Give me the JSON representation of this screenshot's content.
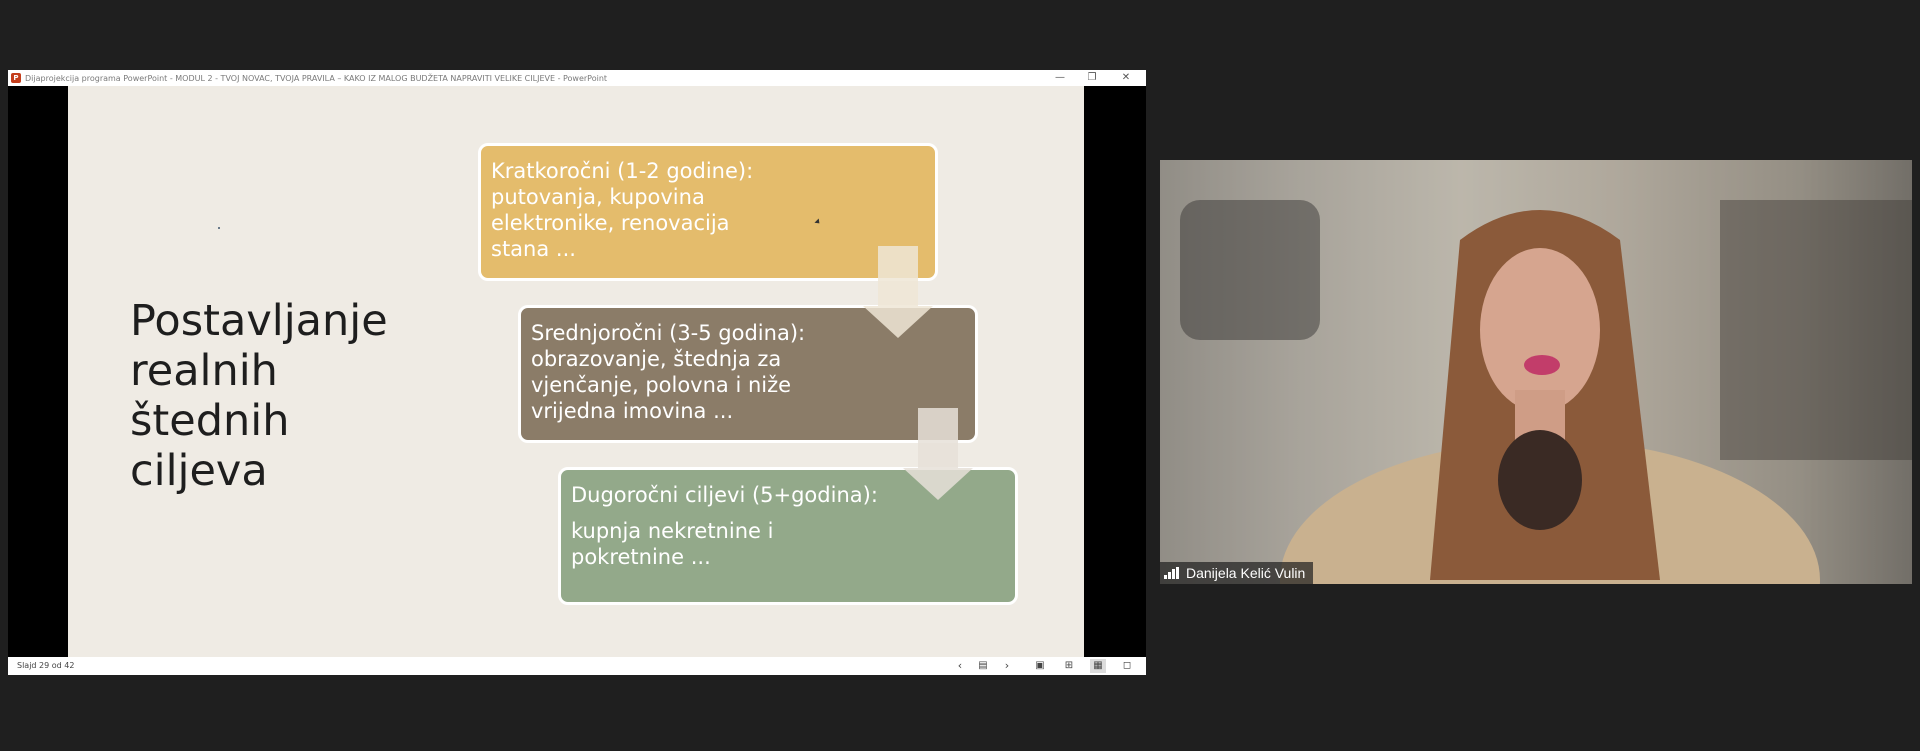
{
  "window": {
    "app_icon": "powerpoint-icon",
    "title": "Dijaprojekcija programa PowerPoint  -  MODUL 2 - TVOJ NOVAC, TVOJA PRAVILA – KAKO IZ MALOG BUDŽETA NAPRAVITI VELIKE CILJEVE - PowerPoint",
    "controls": {
      "minimize": "—",
      "restore": "❐",
      "close": "✕"
    }
  },
  "slide": {
    "heading": [
      "Postavljanje",
      "realnih",
      "štednih",
      "ciljeva"
    ],
    "boxes": {
      "short": [
        "Kratkoročni (1-2 godine):",
        "putovanja, kupovina",
        "elektronike, renovacija",
        "stana ..."
      ],
      "mid": [
        "Srednjoročni (3-5 godina):",
        "obrazovanje, štednja za",
        "vjenčanje, polovna i niže",
        "vrijedna imovina ..."
      ],
      "long": [
        "Dugoročni ciljevi (5+godina):",
        "kupnja nekretnine i",
        "pokretnine ..."
      ]
    },
    "colors": {
      "short": "#e4bc6c",
      "mid": "#8b7c68",
      "long": "#93a98a",
      "background": "#efebe4"
    }
  },
  "statusbar": {
    "slide_counter": "Slajd 29 od 42",
    "prev": "‹",
    "slides_list": "▤",
    "next": "›",
    "views": {
      "normal": "▣",
      "sorter": "⊞",
      "reading": "▦",
      "slideshow": "◻"
    }
  },
  "video": {
    "participant_name": "Danijela Kelić Vulin",
    "signal_icon": "signal-strength-icon"
  }
}
